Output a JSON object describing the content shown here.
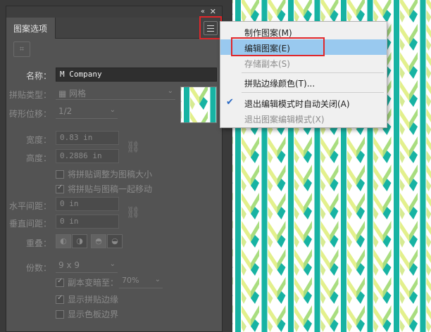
{
  "panel": {
    "title": "图案选项",
    "collapse_glyph": "«",
    "close_glyph": "✕",
    "menu_icon": "hamburger-menu-icon",
    "tool_icon": "tile-edit-tool-icon",
    "name_label": "名称：",
    "name_value": "M Company",
    "tile_type_label": "拼贴类型：",
    "tile_type_value": "网格",
    "brick_offset_label": "砖形位移：",
    "brick_offset_value": "1/2",
    "width_label": "宽度：",
    "width_value": "0.83 in",
    "height_label": "高度：",
    "height_value": "0.2886 in",
    "resize_check": "将拼贴调整为图稿大小",
    "move_check": "将拼贴与图稿一起移动",
    "h_spacing_label": "水平间距：",
    "h_spacing_value": "0 in",
    "v_spacing_label": "垂直间距：",
    "v_spacing_value": "0 in",
    "overlap_label": "重叠：",
    "copies_label": "份数：",
    "copies_value": "9 x 9",
    "dim_copies_label": "副本变暗至：",
    "dim_copies_value": "70%",
    "show_tile_edge": "显示拼贴边缘",
    "show_swatch_bounds": "显示色板边界"
  },
  "menu": {
    "items": [
      {
        "label": "制作图案(M)",
        "state": "normal"
      },
      {
        "label": "编辑图案(E)",
        "state": "hover"
      },
      {
        "label": "存储副本(S)",
        "state": "disabled"
      },
      {
        "label": "拼贴边缘颜色(T)...",
        "state": "normal"
      },
      {
        "label": "退出编辑模式时自动关闭(A)",
        "state": "checked"
      },
      {
        "label": "退出图案编辑模式(X)",
        "state": "disabled"
      }
    ]
  },
  "colors": {
    "teal": "#17b3a3",
    "yellow_green": "#e3f08c",
    "light_green": "#a9dd7f",
    "highlight_red": "#e0262a",
    "menu_hover": "#99c9ef"
  }
}
